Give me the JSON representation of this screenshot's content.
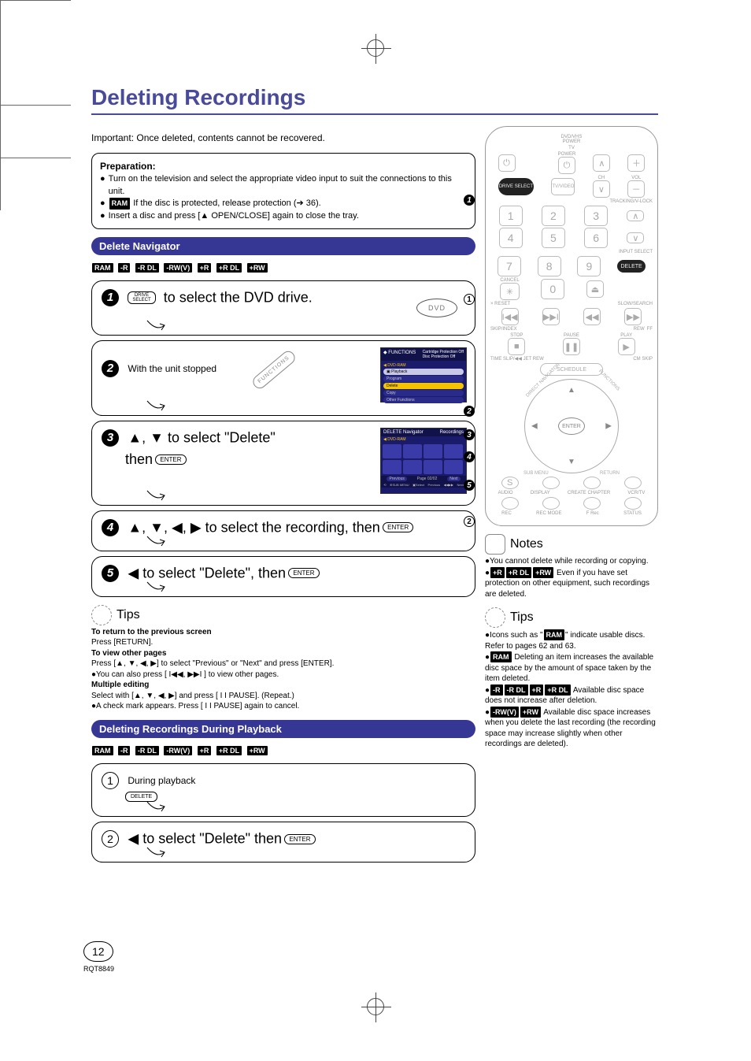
{
  "page_title": "Deleting Recordings",
  "page_number": "12",
  "doc_code": "RQT8849",
  "intro": "Important: Once deleted, contents cannot be recovered.",
  "preparation": {
    "heading": "Preparation:",
    "item1": "Turn on the television and select the appropriate video input to suit the connections to this unit.",
    "item2a": "If the disc is protected, release protection (➔ 36).",
    "item2_badge": "RAM",
    "item3": "Insert a disc and press [▲ OPEN/CLOSE] again to close the tray."
  },
  "sections": {
    "nav": "Delete Navigator",
    "playback": "Deleting Recordings During Playback"
  },
  "disc_badges": [
    "RAM",
    "-R",
    "-R DL",
    "-RW(V)",
    "+R",
    "+R DL",
    "+RW"
  ],
  "step1": {
    "key_top": "DRIVE",
    "key_bot": "SELECT",
    "text": "to select the DVD drive.",
    "pill": "DVD"
  },
  "step2": {
    "text": "With the unit stopped",
    "func_label": "FUNCTIONS",
    "thumb_title": "FUNCTIONS",
    "thumb_tag": "DVD-RAM",
    "thumb_note1": "Cartridge Protection Off",
    "thumb_note2": "Disc Protection Off",
    "menu": [
      "Playback",
      "Program",
      "Delete",
      "Copy",
      "Other Functions"
    ]
  },
  "step3": {
    "line1_pre": "▲, ▼ to select \"Delete\"",
    "line2_pre": "then",
    "enter": "ENTER",
    "thumb_title": "DELETE Navigator",
    "thumb_sub": "Recordings",
    "thumb_tag": "DVD-RAM",
    "foot_prev": "Previous",
    "foot_page": "Page 02/02",
    "foot_next": "Next",
    "foot_hint_submenu": "SUB MENU",
    "foot_hint_select": "Select",
    "foot_hint_prev": "Previous",
    "foot_hint_next": "Next"
  },
  "step4": {
    "text_pre": "▲, ▼, ◀, ▶ to select the recording, then",
    "enter": "ENTER"
  },
  "step5": {
    "text_pre": "◀ to select \"Delete\", then",
    "enter": "ENTER"
  },
  "tips_left": {
    "heading": "Tips",
    "h1": "To return to the previous screen",
    "l1": "Press [RETURN].",
    "h2": "To view other pages",
    "l2a": "Press [▲, ▼, ◀, ▶] to select \"Previous\" or \"Next\" and press [ENTER].",
    "l2b": "You can also press [ I◀◀, ▶▶I ] to view other pages.",
    "h3": "Multiple editing",
    "l3a": "Select with [▲, ▼, ◀, ▶] and press [ I I PAUSE]. (Repeat.)",
    "l3b": "A check mark appears. Press [ I I PAUSE] again to cancel."
  },
  "pb_step1": {
    "text": "During playback",
    "key": "DELETE"
  },
  "pb_step2": {
    "text_pre": "◀ to select \"Delete\" then",
    "enter": "ENTER"
  },
  "notes": {
    "heading": "Notes",
    "n1": "You cannot delete while recording or copying.",
    "n2_badges": [
      "+R",
      "+R DL",
      "+RW"
    ],
    "n2": "Even if you have set protection on other equipment, such recordings are deleted."
  },
  "tips_right": {
    "heading": "Tips",
    "t1a": "Icons such as \"",
    "t1_badge": "RAM",
    "t1b": "\" indicate usable discs. Refer to pages 62 and 63.",
    "t2_badge": "RAM",
    "t2": "Deleting an item increases the available disc space by the amount of space taken by the item deleted.",
    "t3_badges": [
      "-R",
      "-R DL",
      "+R",
      "+R DL"
    ],
    "t3": "Available disc space does not increase after deletion.",
    "t4_badges": [
      "-RW(V)",
      "+RW"
    ],
    "t4": "Available disc space increases when you delete the last recording (the recording space may increase slightly when other recordings are deleted)."
  },
  "remote": {
    "top_label1": "DVD/VHS",
    "top_label2": "POWER",
    "tv_label": "TV",
    "tv_power": "POWER",
    "ch": "CH",
    "vol": "VOL",
    "drive_select": "DRIVE SELECT",
    "tvvideo": "TV/VIDEO",
    "tracking": "TRACKING/V-LOCK",
    "input_select": "INPUT SELECT",
    "delete": "DELETE",
    "cancel": "CANCEL",
    "reset": "× RESET",
    "slow": "SLOW/SEARCH",
    "skip": "SKIP/INDEX",
    "rew": "REW",
    "ff": "FF",
    "stop": "STOP",
    "pause": "PAUSE",
    "play": "PLAY",
    "timeslip": "TIME SLIP/◀◀ JET REW",
    "cmskip": "CM SKIP",
    "schedule": "SCHEDULE",
    "enter": "ENTER",
    "directnav": "DIRECT NAVIGATOR",
    "functions": "FUNCTIONS",
    "submenu": "SUB MENU",
    "return": "RETURN",
    "s_btn": "S",
    "audio": "AUDIO",
    "display": "DISPLAY",
    "create_chapter": "CREATE CHAPTER",
    "vcrtv": "VCR/TV",
    "rec": "REC",
    "recmode": "REC MODE",
    "frec": "F Rec",
    "status": "STATUS"
  }
}
